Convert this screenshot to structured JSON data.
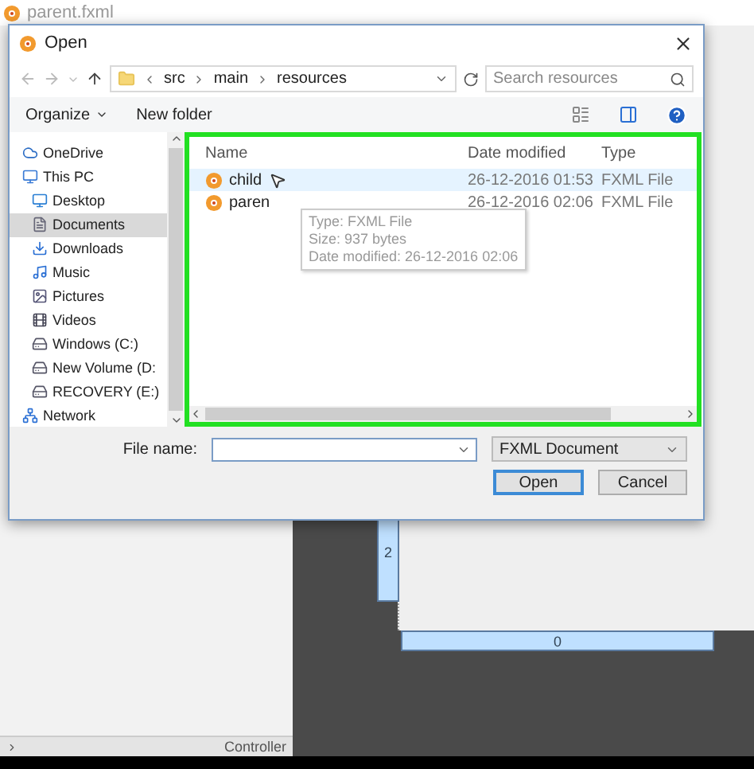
{
  "app": {
    "title": "parent.fxml",
    "controller_label": "Controller",
    "rulers": [
      {
        "kind": "vertical",
        "label": "2"
      },
      {
        "kind": "horizontal",
        "label": "0"
      }
    ]
  },
  "dialog": {
    "title": "Open",
    "path": [
      "src",
      "main",
      "resources"
    ],
    "search": {
      "placeholder": "Search resources"
    },
    "toolbar": {
      "organize": "Organize",
      "new_folder": "New folder"
    },
    "nav": [
      {
        "label": "OneDrive",
        "kind": "cloud",
        "selected": false
      },
      {
        "label": "This PC",
        "kind": "pc",
        "selected": false,
        "children": [
          {
            "label": "Desktop",
            "kind": "desktop",
            "selected": false
          },
          {
            "label": "Documents",
            "kind": "documents",
            "selected": true
          },
          {
            "label": "Downloads",
            "kind": "downloads",
            "selected": false
          },
          {
            "label": "Music",
            "kind": "music",
            "selected": false
          },
          {
            "label": "Pictures",
            "kind": "pictures",
            "selected": false
          },
          {
            "label": "Videos",
            "kind": "videos",
            "selected": false
          },
          {
            "label": "Windows (C:)",
            "kind": "drive",
            "selected": false
          },
          {
            "label": "New Volume (D:",
            "kind": "drive",
            "selected": false
          },
          {
            "label": "RECOVERY (E:)",
            "kind": "drive",
            "selected": false
          }
        ]
      },
      {
        "label": "Network",
        "kind": "network",
        "selected": false
      }
    ],
    "columns": [
      "Name",
      "Date modified",
      "Type"
    ],
    "files": [
      {
        "name": "child",
        "date": "26-12-2016 01:53",
        "type": "FXML File",
        "selected": true
      },
      {
        "name": "paren",
        "date": "26-12-2016 02:06",
        "type": "FXML File",
        "selected": false
      }
    ],
    "tooltip": [
      "Type: FXML File",
      "Size: 937 bytes",
      "Date modified: 26-12-2016 02:06"
    ],
    "file_name_label": "File name:",
    "filter": "FXML Document",
    "buttons": [
      {
        "label": "Open",
        "kind": "default"
      },
      {
        "label": "Cancel",
        "kind": "normal"
      }
    ]
  }
}
